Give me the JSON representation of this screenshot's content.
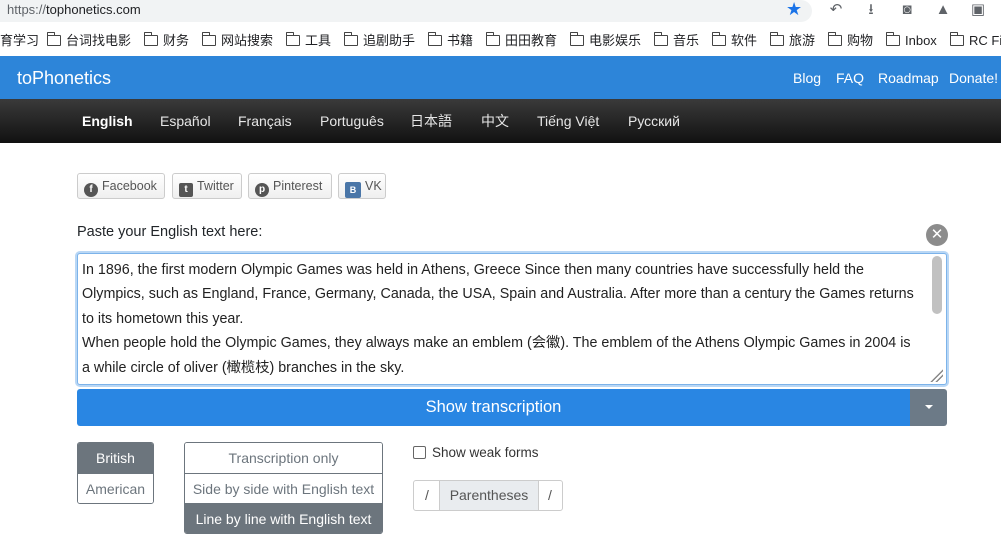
{
  "browser": {
    "url_protocol": "https://",
    "url_host": "tophonetics.com",
    "bookmarks": [
      "育学习",
      "台词找电影",
      "财务",
      "网站搜索",
      "工具",
      "追剧助手",
      "书籍",
      "田田教育",
      "电影娱乐",
      "音乐",
      "软件",
      "旅游",
      "购物",
      "Inbox",
      "RC Fir"
    ]
  },
  "header": {
    "brand": "toPhonetics",
    "links": [
      "Blog",
      "FAQ",
      "Roadmap",
      "Donate!"
    ]
  },
  "languages": {
    "items": [
      "English",
      "Español",
      "Français",
      "Português",
      "日本語",
      "中文",
      "Tiếng Việt",
      "Русский"
    ],
    "active": "English"
  },
  "share": {
    "facebook": "Facebook",
    "twitter": "Twitter",
    "pinterest": "Pinterest",
    "vk": "VK",
    "vk_glyph": "B"
  },
  "input": {
    "label": "Paste your English text here:",
    "clear_glyph": "✕",
    "lines": [
      "In 1896, the first modern Olympic Games was held in Athens, Greece Since then many countries have successfully held the",
      "Olympics, such as England, France, Germany, Canada, the USA, Spain and Australia. After more than a century the Games returns",
      "to its hometown this year.",
      "When people hold the Olympic Games, they always make an emblem (会徽). The emblem of the Athens Olympic Games in 2004 is",
      "a while circle of oliver (橄榄枝) branches in the sky."
    ]
  },
  "actions": {
    "show_button": "Show transcription"
  },
  "options": {
    "accent": [
      "British",
      "American"
    ],
    "accent_selected": "British",
    "display_mode": [
      "Transcription only",
      "Side by side with English text",
      "Line by line with English text"
    ],
    "display_selected": "Line by line with English text",
    "weak_forms_label": "Show weak forms",
    "weak_forms_checked": false,
    "bracket_open": "/",
    "bracket_label": "Parentheses",
    "bracket_close": "/"
  },
  "colors": {
    "primary": "#2986e3",
    "secondary": "#6c757d",
    "nav_dark": "#111111"
  }
}
